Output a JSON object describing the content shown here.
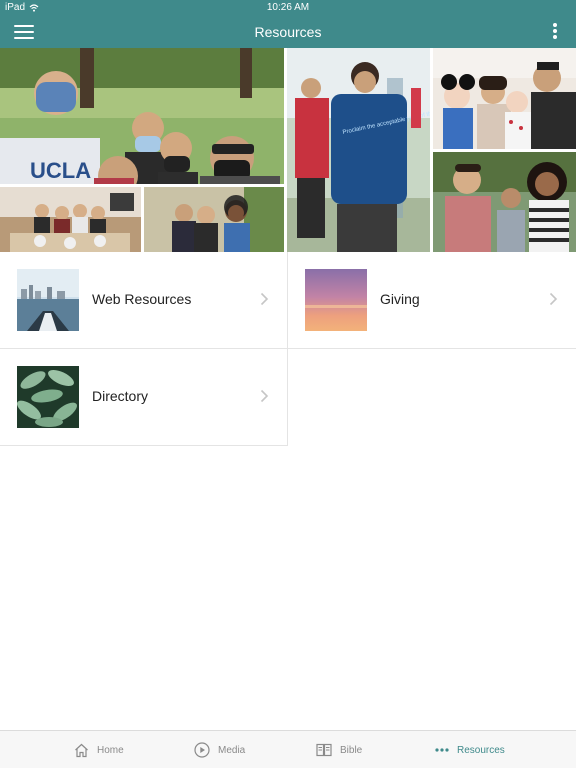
{
  "status_bar": {
    "device": "iPad",
    "time": "10:26 AM"
  },
  "header": {
    "title": "Resources"
  },
  "collage": {
    "photos": [
      "group-selfie-park",
      "friends-dinner-table",
      "friends-smiling-indoors",
      "volunteers-outdoors",
      "mother-baby-father",
      "family-portrait"
    ],
    "shirt_text": "Proclaim the acceptable year of the Lord, the year of Jubilee"
  },
  "resources": [
    {
      "label": "Web Resources",
      "thumb": "city-skyline-water"
    },
    {
      "label": "Giving",
      "thumb": "sunset-sky"
    },
    {
      "label": "Directory",
      "thumb": "leaf-pattern"
    }
  ],
  "tabs": [
    {
      "label": "Home",
      "icon": "home-icon",
      "active": false
    },
    {
      "label": "Media",
      "icon": "play-icon",
      "active": false
    },
    {
      "label": "Bible",
      "icon": "book-icon",
      "active": false
    },
    {
      "label": "Resources",
      "icon": "more-dots-icon",
      "active": true
    }
  ],
  "colors": {
    "accent": "#3f8a8b",
    "tab_inactive": "#8a8a8a"
  }
}
